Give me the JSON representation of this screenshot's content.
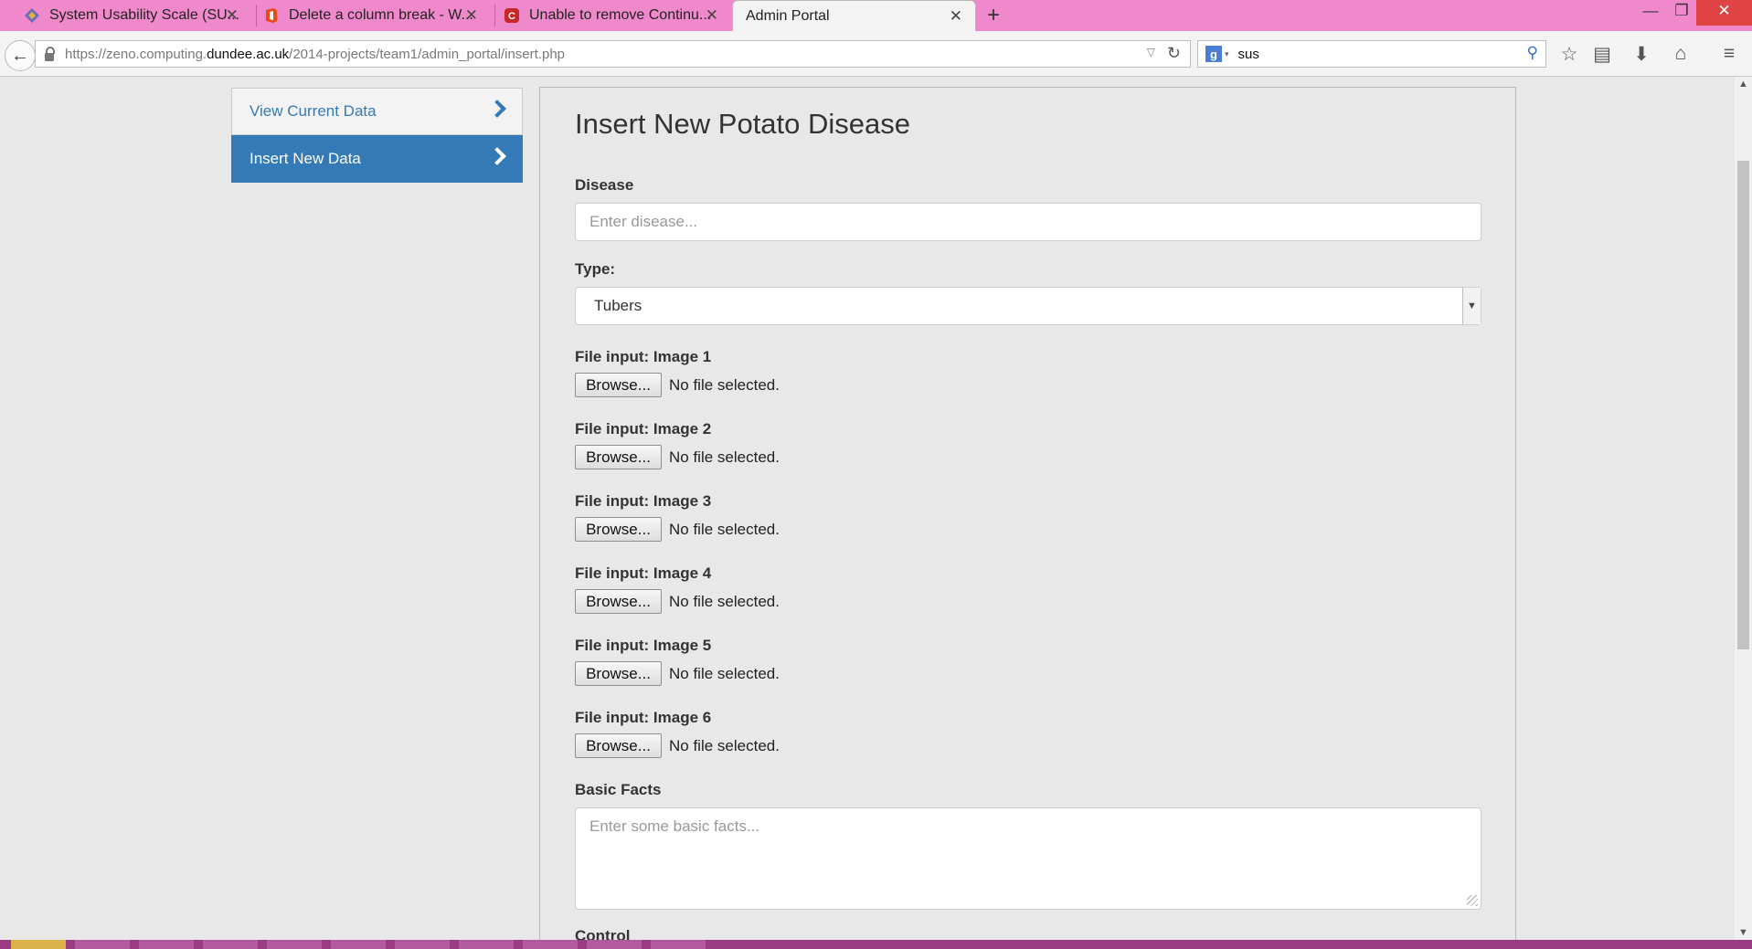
{
  "browser": {
    "tabs": [
      {
        "title": "System Usability Scale (SU...",
        "icon": "usability-icon",
        "active": false
      },
      {
        "title": "Delete a column break - W...",
        "icon": "office-icon",
        "active": false
      },
      {
        "title": "Unable to remove Continu...",
        "icon": "forum-icon",
        "active": false
      },
      {
        "title": "Admin Portal",
        "icon": "",
        "active": true
      }
    ],
    "url_prefix": "https://zeno.computing.",
    "url_host": "dundee.ac.uk",
    "url_path": "/2014-projects/team1/admin_portal/insert.php",
    "search_value": "sus",
    "search_engine_label": "g"
  },
  "sidebar": {
    "items": [
      {
        "label": "View Current Data",
        "active": false
      },
      {
        "label": "Insert New Data",
        "active": true
      }
    ]
  },
  "form": {
    "title": "Insert New Potato Disease",
    "disease_label": "Disease",
    "disease_placeholder": "Enter disease...",
    "type_label": "Type:",
    "type_value": "Tubers",
    "file_inputs": [
      {
        "label": "File input: Image 1",
        "button": "Browse...",
        "status": "No file selected."
      },
      {
        "label": "File input: Image 2",
        "button": "Browse...",
        "status": "No file selected."
      },
      {
        "label": "File input: Image 3",
        "button": "Browse...",
        "status": "No file selected."
      },
      {
        "label": "File input: Image 4",
        "button": "Browse...",
        "status": "No file selected."
      },
      {
        "label": "File input: Image 5",
        "button": "Browse...",
        "status": "No file selected."
      },
      {
        "label": "File input: Image 6",
        "button": "Browse...",
        "status": "No file selected."
      }
    ],
    "basic_facts_label": "Basic Facts",
    "basic_facts_placeholder": "Enter some basic facts...",
    "control_label": "Control"
  },
  "colors": {
    "tabbar": "#f089cc",
    "accent": "#337ab7",
    "taskbar": "#9b3b82"
  }
}
